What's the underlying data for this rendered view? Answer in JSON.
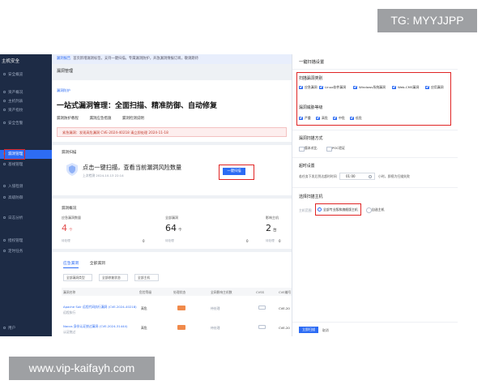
{
  "watermarks": {
    "top": "TG: MYYJJPP",
    "bottom": "www.vip-kaifayh.com"
  },
  "sidebar": {
    "brand": "主机安全",
    "items": [
      {
        "label": "安全概览"
      },
      {
        "label": "资产概况"
      },
      {
        "label": "主机列表"
      },
      {
        "label": "资产指纹"
      },
      {
        "label": "安全告警"
      },
      {
        "label": "漏洞管理"
      },
      {
        "label": "基线管理"
      },
      {
        "label": "入侵检测"
      },
      {
        "label": "高级防御"
      },
      {
        "label": "日志分析"
      },
      {
        "label": "授权管理"
      },
      {
        "label": "定时任务"
      }
    ],
    "footer_user": "用户"
  },
  "main": {
    "notice_tag": "漏洞报告",
    "notice_text": "首页新增漏洞标签，支持一键扫描，专属漏洞防护，开放漏洞情报订阅，敬请期待",
    "breadcrumb": "漏洞管理",
    "hero_badge": "漏洞防护",
    "hero_title": "一站式漏洞管理：全面扫描、精准防御、自动修复",
    "hero_tabs": [
      "漏洞防护教程",
      "漏洞应急措施",
      "漏洞检测说明"
    ],
    "alert_text": "紧急漏洞：发现高危漏洞 CVE-2024-40218 请立即处理  2024-11-18",
    "scan_section": "漏洞扫描",
    "scan_title": "点击一键扫描，查看当前漏洞风险数量",
    "scan_sub": "上次检测 2024-10-13 22:14",
    "scan_button": "一键扫描",
    "overview_label": "漏洞概况",
    "stats": [
      {
        "title": "应急漏洞数量",
        "value": "4",
        "unit": "个",
        "foot": "待处理",
        "zero": "0"
      },
      {
        "title": "全部漏洞",
        "value": "64",
        "unit": "个",
        "foot": "待处理",
        "zero": "0"
      },
      {
        "title": "影响主机",
        "value": "2",
        "unit": "台",
        "foot": "待处理",
        "zero": "0"
      }
    ],
    "tabs": {
      "active": "应急漏洞",
      "other": "全部漏洞"
    },
    "filters": [
      "全部漏洞类型",
      "全部修复状态",
      "全部主机"
    ],
    "table_headers": [
      "漏洞名称",
      "危险等级",
      "处理状态",
      "全网影响主机数",
      "CVSS",
      "CVE编号"
    ],
    "rows": [
      {
        "name": "Apache Solr 远程代码执行漏洞 (CVE-2024-40218)",
        "tag": "远程执行",
        "level": "高危",
        "status": "待处理",
        "cve": "CVE-20"
      },
      {
        "name": "Nacos 身份认证绕过漏洞 (CVE-2024-31444)",
        "tag": "认证绕过",
        "level": "高危",
        "status": "待处理",
        "cve": "CVE-20"
      }
    ]
  },
  "drawer": {
    "title": "一键扫描设置",
    "types_section": "扫描漏洞类别",
    "types": [
      "应急漏洞",
      "Linux软件漏洞",
      "Windows系统漏洞",
      "Web-CMS漏洞",
      "应用漏洞"
    ],
    "levels_section": "漏洞威胁等级",
    "levels": [
      "严重",
      "高危",
      "中危",
      "低危"
    ],
    "method_section": "漏洞扫描方式",
    "methods": [
      "版本对比",
      "POC验证"
    ],
    "timeout_section": "超时设置",
    "timeout_prefix": "若任务下发后到达超时时间",
    "timeout_value": "01:00",
    "timeout_suffix": "小时，即视为扫描失败",
    "hosts_section": "选择扫描主机",
    "hosts_prefix": "主机范围",
    "hosts": [
      "全部专业版和旗舰版主机",
      "自选主机"
    ],
    "start_button": "立即扫描",
    "cancel_button": "取消"
  },
  "colors": {
    "primary": "#2d6cf4",
    "sidebar": "#1d2b45",
    "highlight": "#e02424",
    "danger": "#f08a4b"
  }
}
